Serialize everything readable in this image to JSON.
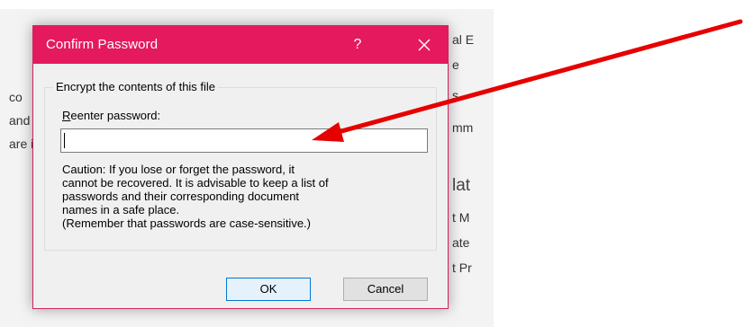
{
  "dialog": {
    "title": "Confirm Password",
    "help_label": "?",
    "group_label": "Encrypt the contents of this file",
    "reenter_label": "Reenter password:",
    "password_value": "",
    "caution_lines": [
      "Caution: If you lose or forget the password, it",
      "cannot be recovered. It is advisable to keep a list of",
      "passwords and their corresponding document",
      "names in a safe place.",
      "(Remember that passwords are case-sensitive.)"
    ],
    "ok_label": "OK",
    "cancel_label": "Cancel"
  },
  "background_fragments": {
    "right": [
      "al E",
      "e",
      "s",
      "mm",
      "lat",
      "t M",
      "ate",
      "t Pr"
    ],
    "left": [
      "co",
      "and",
      "are i"
    ]
  },
  "colors": {
    "titlebar": "#e5195e",
    "dialog_bg": "#f0f0f0",
    "arrow": "#e60000",
    "ok_border": "#0078d7"
  },
  "icons": {
    "help": "question-mark",
    "close": "close-x",
    "annotation": "red-arrow"
  }
}
